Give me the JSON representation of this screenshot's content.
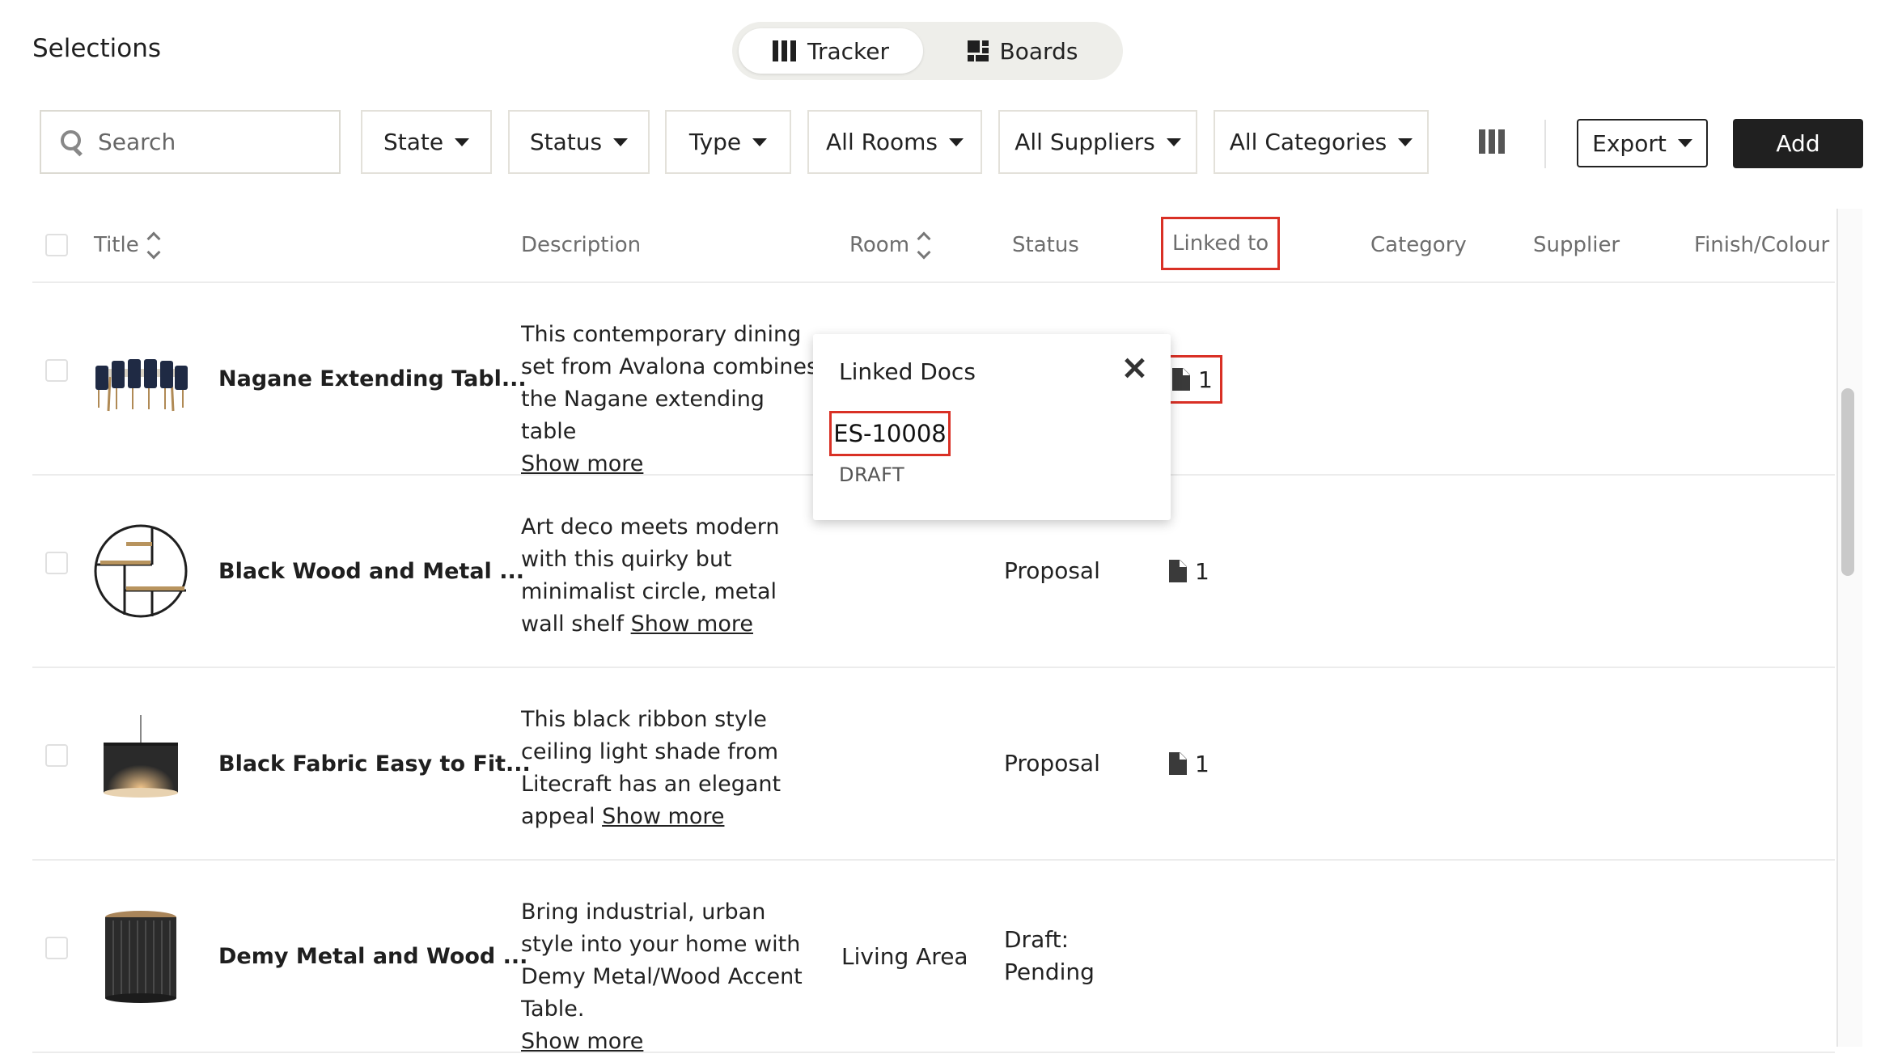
{
  "page": {
    "title": "Selections"
  },
  "view_toggle": {
    "tracker": "Tracker",
    "boards": "Boards",
    "active": "Tracker"
  },
  "search": {
    "placeholder": "Search",
    "value": ""
  },
  "filters": {
    "state": "State",
    "status": "Status",
    "type": "Type",
    "rooms": "All Rooms",
    "suppliers": "All Suppliers",
    "categories": "All Categories"
  },
  "actions": {
    "export": "Export",
    "add": "Add"
  },
  "columns": {
    "title": "Title",
    "description": "Description",
    "room": "Room",
    "status": "Status",
    "linked_to": "Linked to",
    "category": "Category",
    "supplier": "Supplier",
    "finish_colour": "Finish/Colour"
  },
  "rows": [
    {
      "title": "Nagane Extending Tabl...",
      "description": "This contemporary dining set from Avalona combines the Nagane extending table",
      "more": "Show more",
      "room": "",
      "status": "",
      "linked_count": "1"
    },
    {
      "title": "Black Wood and Metal ...",
      "description": "Art deco meets modern with this quirky but minimalist circle, metal wall shelf",
      "more": "Show more",
      "room": "",
      "status": "Proposal",
      "linked_count": "1"
    },
    {
      "title": "Black Fabric Easy to Fit...",
      "description": "This black ribbon style ceiling light shade from Litecraft has an elegant appeal",
      "more": "Show more",
      "room": "",
      "status": "Proposal",
      "linked_count": "1"
    },
    {
      "title": "Demy Metal and Wood ...",
      "description": "Bring industrial, urban style into your home with Demy Metal/Wood Accent Table.",
      "more": "Show more",
      "room": "Living Area",
      "status_line1": "Draft:",
      "status_line2": "Pending",
      "linked_count": ""
    }
  ],
  "popover": {
    "title": "Linked Docs",
    "doc_id": "ES-10008",
    "doc_state": "DRAFT"
  },
  "colors": {
    "accent_dark": "#202020",
    "highlight": "#d93025",
    "toggle_bg": "#eeeeea"
  },
  "icons": [
    "tracker-columns-icon",
    "boards-grid-icon",
    "search-icon",
    "caret-down-icon",
    "column-settings-icon",
    "sort-icon",
    "document-icon",
    "close-icon"
  ]
}
